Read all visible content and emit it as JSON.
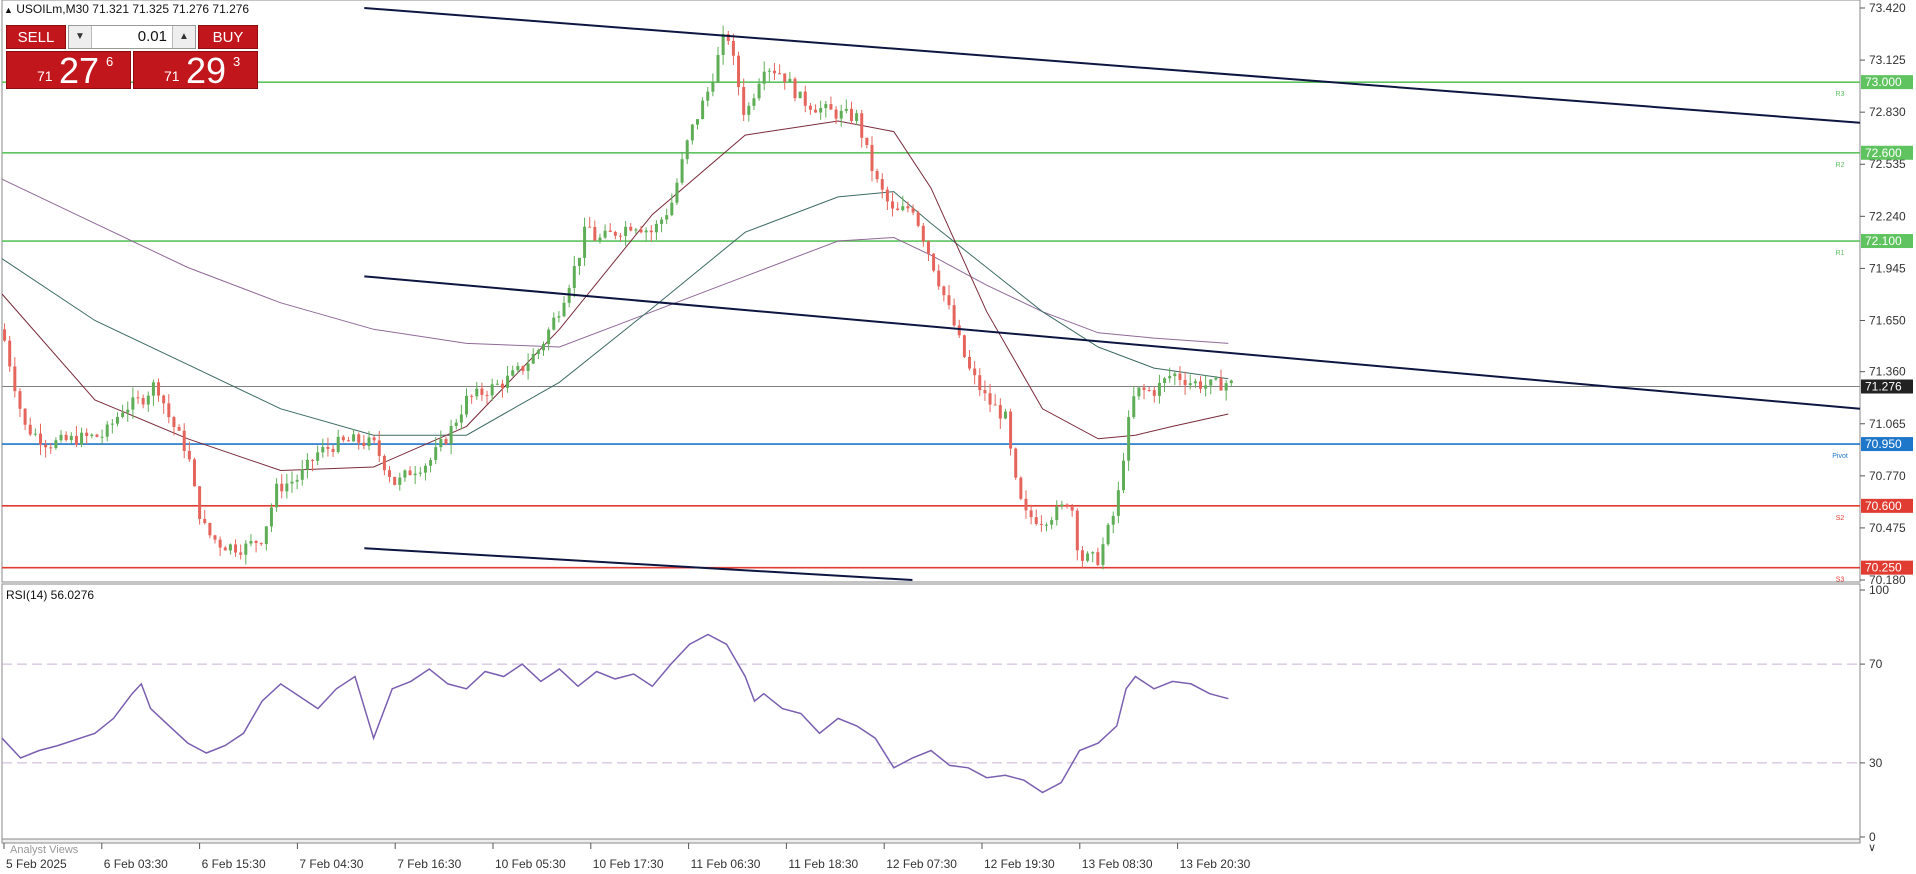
{
  "header": {
    "symbol_line": "USOILm,M30  71.321 71.325 71.276 71.276"
  },
  "trade_panel": {
    "sell_label": "SELL",
    "buy_label": "BUY",
    "lot_size": "0.01",
    "sell_price": {
      "prefix": "71",
      "big": "27",
      "sup": "6"
    },
    "buy_price": {
      "prefix": "71",
      "big": "29",
      "sup": "3"
    }
  },
  "chart_data": [
    {
      "type": "candlestick",
      "title": "USOILm,M30",
      "ylim": [
        70.18,
        73.42
      ],
      "y_ticks": [
        "73.420",
        "73.125",
        "72.830",
        "72.535",
        "72.240",
        "71.945",
        "71.650",
        "71.360",
        "71.065",
        "70.770",
        "70.475",
        "70.180"
      ],
      "x_tick_labels": [
        "5 Feb 2025",
        "6 Feb 03:30",
        "6 Feb 15:30",
        "7 Feb 04:30",
        "7 Feb 16:30",
        "10 Feb 05:30",
        "10 Feb 17:30",
        "11 Feb 06:30",
        "11 Feb 18:30",
        "12 Feb 07:30",
        "12 Feb 19:30",
        "13 Feb 08:30",
        "13 Feb 20:30"
      ],
      "current_price": "71.276",
      "levels": [
        {
          "value": 73.0,
          "price_label": "73.000",
          "name": "R3",
          "color": "#5fc35f"
        },
        {
          "value": 72.6,
          "price_label": "72.600",
          "name": "R2",
          "color": "#5fc35f"
        },
        {
          "value": 72.1,
          "price_label": "72.100",
          "name": "R1",
          "color": "#5fc35f"
        },
        {
          "value": 70.95,
          "price_label": "70.950",
          "name": "Pivot",
          "color": "#1f77c9"
        },
        {
          "value": 70.6,
          "price_label": "70.600",
          "name": "S2",
          "color": "#e03c31"
        },
        {
          "value": 70.25,
          "price_label": "70.250",
          "name": "S3",
          "color": "#e03c31"
        }
      ],
      "channel_lines": [
        {
          "x0": 0.195,
          "y0": 73.42,
          "x1": 1.0,
          "y1": 72.77
        },
        {
          "x0": 0.195,
          "y0": 71.9,
          "x1": 1.0,
          "y1": 71.15
        },
        {
          "x0": 0.195,
          "y0": 70.36,
          "x1": 0.49,
          "y1": 70.18
        }
      ],
      "close_path": [
        [
          0.0,
          71.6
        ],
        [
          0.012,
          71.05
        ],
        [
          0.025,
          70.95
        ],
        [
          0.04,
          70.98
        ],
        [
          0.055,
          71.0
        ],
        [
          0.065,
          71.15
        ],
        [
          0.075,
          71.2
        ],
        [
          0.083,
          71.3
        ],
        [
          0.09,
          71.1
        ],
        [
          0.1,
          70.9
        ],
        [
          0.105,
          70.6
        ],
        [
          0.11,
          70.45
        ],
        [
          0.118,
          70.38
        ],
        [
          0.13,
          70.36
        ],
        [
          0.14,
          70.42
        ],
        [
          0.148,
          70.7
        ],
        [
          0.16,
          70.76
        ],
        [
          0.17,
          70.9
        ],
        [
          0.18,
          70.95
        ],
        [
          0.19,
          70.97
        ],
        [
          0.2,
          70.95
        ],
        [
          0.205,
          70.85
        ],
        [
          0.212,
          70.72
        ],
        [
          0.22,
          70.8
        ],
        [
          0.23,
          70.85
        ],
        [
          0.24,
          71.0
        ],
        [
          0.25,
          71.2
        ],
        [
          0.26,
          71.25
        ],
        [
          0.27,
          71.3
        ],
        [
          0.28,
          71.38
        ],
        [
          0.29,
          71.5
        ],
        [
          0.3,
          71.72
        ],
        [
          0.31,
          72.0
        ],
        [
          0.315,
          72.2
        ],
        [
          0.32,
          72.1
        ],
        [
          0.33,
          72.15
        ],
        [
          0.34,
          72.2
        ],
        [
          0.35,
          72.15
        ],
        [
          0.36,
          72.3
        ],
        [
          0.37,
          72.7
        ],
        [
          0.38,
          72.95
        ],
        [
          0.39,
          73.3
        ],
        [
          0.395,
          73.05
        ],
        [
          0.4,
          72.8
        ],
        [
          0.41,
          73.1
        ],
        [
          0.42,
          73.05
        ],
        [
          0.43,
          72.9
        ],
        [
          0.44,
          72.85
        ],
        [
          0.45,
          72.82
        ],
        [
          0.46,
          72.8
        ],
        [
          0.47,
          72.45
        ],
        [
          0.48,
          72.25
        ],
        [
          0.49,
          72.3
        ],
        [
          0.5,
          72.0
        ],
        [
          0.51,
          71.7
        ],
        [
          0.52,
          71.38
        ],
        [
          0.53,
          71.2
        ],
        [
          0.54,
          71.1
        ],
        [
          0.545,
          70.75
        ],
        [
          0.55,
          70.55
        ],
        [
          0.56,
          70.52
        ],
        [
          0.57,
          70.58
        ],
        [
          0.575,
          70.65
        ],
        [
          0.58,
          70.3
        ],
        [
          0.59,
          70.3
        ],
        [
          0.6,
          70.6
        ],
        [
          0.605,
          71.0
        ],
        [
          0.61,
          71.25
        ],
        [
          0.62,
          71.25
        ],
        [
          0.63,
          71.35
        ],
        [
          0.64,
          71.3
        ],
        [
          0.65,
          71.28
        ],
        [
          0.66,
          71.3
        ],
        [
          0.663,
          71.28
        ]
      ],
      "ma_fast": [
        [
          0.0,
          71.8
        ],
        [
          0.05,
          71.2
        ],
        [
          0.1,
          70.98
        ],
        [
          0.15,
          70.8
        ],
        [
          0.2,
          70.82
        ],
        [
          0.25,
          71.05
        ],
        [
          0.3,
          71.6
        ],
        [
          0.35,
          72.25
        ],
        [
          0.4,
          72.7
        ],
        [
          0.45,
          72.78
        ],
        [
          0.48,
          72.72
        ],
        [
          0.5,
          72.4
        ],
        [
          0.53,
          71.7
        ],
        [
          0.56,
          71.15
        ],
        [
          0.59,
          70.98
        ],
        [
          0.61,
          71.0
        ],
        [
          0.63,
          71.05
        ],
        [
          0.66,
          71.12
        ]
      ],
      "ma_mid": [
        [
          0.0,
          72.0
        ],
        [
          0.05,
          71.65
        ],
        [
          0.1,
          71.4
        ],
        [
          0.15,
          71.15
        ],
        [
          0.2,
          71.0
        ],
        [
          0.25,
          71.0
        ],
        [
          0.3,
          71.3
        ],
        [
          0.35,
          71.72
        ],
        [
          0.4,
          72.15
        ],
        [
          0.45,
          72.35
        ],
        [
          0.48,
          72.38
        ],
        [
          0.5,
          72.2
        ],
        [
          0.53,
          71.95
        ],
        [
          0.56,
          71.7
        ],
        [
          0.59,
          71.5
        ],
        [
          0.62,
          71.38
        ],
        [
          0.66,
          71.32
        ]
      ],
      "ma_slow": [
        [
          0.0,
          72.45
        ],
        [
          0.05,
          72.2
        ],
        [
          0.1,
          71.95
        ],
        [
          0.15,
          71.75
        ],
        [
          0.2,
          71.6
        ],
        [
          0.25,
          71.52
        ],
        [
          0.3,
          71.5
        ],
        [
          0.35,
          71.7
        ],
        [
          0.4,
          71.9
        ],
        [
          0.45,
          72.1
        ],
        [
          0.48,
          72.12
        ],
        [
          0.5,
          72.02
        ],
        [
          0.53,
          71.85
        ],
        [
          0.56,
          71.7
        ],
        [
          0.59,
          71.58
        ],
        [
          0.62,
          71.55
        ],
        [
          0.66,
          71.52
        ]
      ],
      "colors": {
        "bull": "#5fae57",
        "bear": "#e5655d",
        "ma_fast": "#7a2a3a",
        "ma_mid": "#3d6b64",
        "ma_slow": "#8f6a98",
        "channel": "#0d1640",
        "current": "#808080"
      }
    },
    {
      "type": "line",
      "title": "RSI(14) 56.0276",
      "ylim": [
        0,
        100
      ],
      "y_ticks": [
        "100",
        "70",
        "30",
        "0"
      ],
      "levels": [
        70,
        30
      ],
      "series": [
        {
          "name": "RSI(14)",
          "color": "#7a5fb0",
          "values": [
            [
              0.0,
              40
            ],
            [
              0.01,
              32
            ],
            [
              0.02,
              35
            ],
            [
              0.03,
              37
            ],
            [
              0.05,
              42
            ],
            [
              0.06,
              48
            ],
            [
              0.07,
              58
            ],
            [
              0.075,
              62
            ],
            [
              0.08,
              52
            ],
            [
              0.09,
              45
            ],
            [
              0.1,
              38
            ],
            [
              0.11,
              34
            ],
            [
              0.12,
              37
            ],
            [
              0.13,
              42
            ],
            [
              0.14,
              55
            ],
            [
              0.15,
              62
            ],
            [
              0.16,
              57
            ],
            [
              0.17,
              52
            ],
            [
              0.18,
              60
            ],
            [
              0.19,
              65
            ],
            [
              0.2,
              40
            ],
            [
              0.205,
              50
            ],
            [
              0.21,
              60
            ],
            [
              0.22,
              63
            ],
            [
              0.23,
              68
            ],
            [
              0.24,
              62
            ],
            [
              0.25,
              60
            ],
            [
              0.26,
              67
            ],
            [
              0.27,
              65
            ],
            [
              0.28,
              70
            ],
            [
              0.29,
              63
            ],
            [
              0.3,
              68
            ],
            [
              0.31,
              61
            ],
            [
              0.32,
              67
            ],
            [
              0.33,
              64
            ],
            [
              0.34,
              66
            ],
            [
              0.35,
              61
            ],
            [
              0.36,
              70
            ],
            [
              0.37,
              78
            ],
            [
              0.38,
              82
            ],
            [
              0.39,
              78
            ],
            [
              0.4,
              65
            ],
            [
              0.405,
              55
            ],
            [
              0.41,
              58
            ],
            [
              0.42,
              52
            ],
            [
              0.43,
              50
            ],
            [
              0.44,
              42
            ],
            [
              0.45,
              48
            ],
            [
              0.46,
              45
            ],
            [
              0.47,
              40
            ],
            [
              0.48,
              28
            ],
            [
              0.49,
              32
            ],
            [
              0.5,
              35
            ],
            [
              0.51,
              29
            ],
            [
              0.52,
              28
            ],
            [
              0.53,
              24
            ],
            [
              0.54,
              25
            ],
            [
              0.55,
              23
            ],
            [
              0.56,
              18
            ],
            [
              0.57,
              22
            ],
            [
              0.58,
              35
            ],
            [
              0.59,
              38
            ],
            [
              0.6,
              45
            ],
            [
              0.605,
              60
            ],
            [
              0.61,
              65
            ],
            [
              0.62,
              60
            ],
            [
              0.63,
              63
            ],
            [
              0.64,
              62
            ],
            [
              0.65,
              58
            ],
            [
              0.66,
              56
            ]
          ]
        }
      ]
    }
  ],
  "footer": {
    "label": "Analyst Views"
  }
}
